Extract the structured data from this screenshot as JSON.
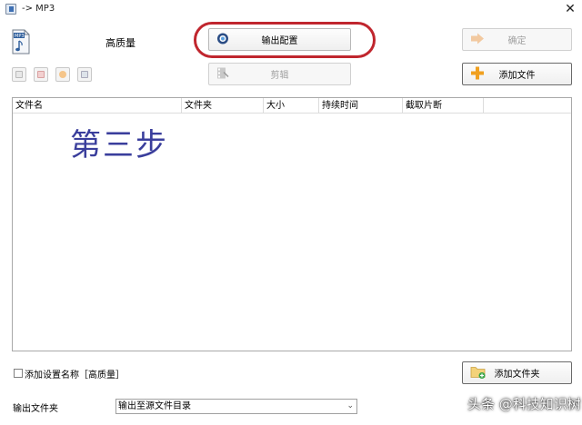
{
  "window": {
    "title": "-> MP3"
  },
  "header": {
    "profile_label": "高质量",
    "file_icon_label": "MP3"
  },
  "buttons": {
    "output_config": "输出配置",
    "edit": "剪辑",
    "confirm": "确定",
    "add_file": "添加文件",
    "add_folder": "添加文件夹"
  },
  "toolbar": {
    "icons": [
      "new-item-icon",
      "remove-item-icon",
      "play-icon",
      "info-icon"
    ]
  },
  "list": {
    "columns": [
      "文件名",
      "文件夹",
      "大小",
      "持续时间",
      "截取片断"
    ]
  },
  "annotation": {
    "step_text": "第三步"
  },
  "footer": {
    "add_setting_name_label": "添加设置名称［高质量］",
    "add_setting_name_checked": false,
    "output_folder_label": "输出文件夹",
    "output_folder_value": "输出至源文件目录"
  },
  "watermark": {
    "text": "头条 @科技知识树"
  },
  "colors": {
    "highlight_oval": "#c0262e",
    "step_text": "#3a3e9c",
    "add_icon": "#f0a020"
  }
}
